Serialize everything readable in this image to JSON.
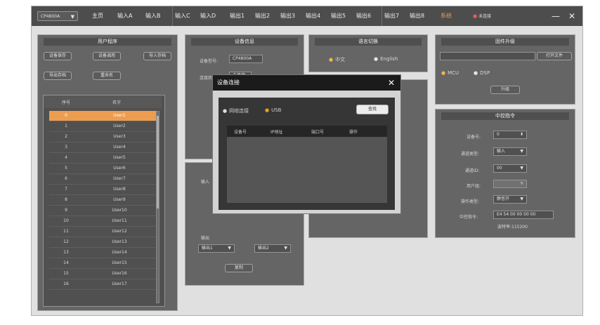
{
  "topbar": {
    "device_select": "CP4800A",
    "nav": [
      "主页",
      "输入A",
      "输入B",
      "输入C",
      "输入D",
      "输出1",
      "输出2",
      "输出3",
      "输出4",
      "输出5",
      "输出6",
      "输出7",
      "输出8",
      "系统"
    ],
    "active_nav": "系统",
    "connection_status": "未连接",
    "minimize": "—",
    "close": "✕"
  },
  "user_program": {
    "title": "用户程序",
    "buttons": [
      "设备保存",
      "设备调用",
      "导入存档",
      "导出存档",
      "重命名"
    ],
    "table": {
      "headers": [
        "序号",
        "名字"
      ],
      "rows": [
        [
          "0",
          "User1"
        ],
        [
          "1",
          "User2"
        ],
        [
          "2",
          "User3"
        ],
        [
          "3",
          "User4"
        ],
        [
          "4",
          "User5"
        ],
        [
          "5",
          "User6"
        ],
        [
          "6",
          "User7"
        ],
        [
          "7",
          "User8"
        ],
        [
          "8",
          "User9"
        ],
        [
          "9",
          "User10"
        ],
        [
          "10",
          "User11"
        ],
        [
          "11",
          "User12"
        ],
        [
          "12",
          "User13"
        ],
        [
          "13",
          "User14"
        ],
        [
          "14",
          "User15"
        ],
        [
          "15",
          "User16"
        ],
        [
          "16",
          "User17"
        ]
      ],
      "selected_index": 0
    }
  },
  "device_info": {
    "title": "设备信息",
    "model_label": "设备型号:",
    "model_value": "CP4800A",
    "conn_label": "连接状态:",
    "conn_value": "未连接",
    "output_label": "输出",
    "output_from": "输出1",
    "output_to": "输出2",
    "copy_button": "复制",
    "partial_input": "输入"
  },
  "language": {
    "title": "语言切换",
    "options": [
      "中文",
      "English"
    ],
    "selected": "中文"
  },
  "firmware": {
    "title": "固件升级",
    "path_value": "",
    "open_button": "打开文件",
    "targets": [
      "MCU",
      "DSP"
    ],
    "selected": "MCU",
    "upgrade_button": "升级"
  },
  "central_control": {
    "title": "中控指令",
    "device_no_label": "设备号:",
    "device_no": "0",
    "channel_type_label": "通道类型:",
    "channel_type": "输入",
    "channel_id_label": "通道ID:",
    "channel_id": "00",
    "user_label": "用户组:",
    "user_value": "",
    "op_type_label": "操作类型:",
    "op_type": "静音开",
    "command_label": "中控指令:",
    "command_value": "E4 54 00 00 00 00",
    "baud_text": "波特率:115200"
  },
  "dialog": {
    "title": "设备连接",
    "close": "✕",
    "modes": [
      "网络连接",
      "USB"
    ],
    "selected_mode": "USB",
    "search_button": "查找",
    "grid_headers": [
      "设备号",
      "IP地址",
      "端口号",
      "操作"
    ]
  },
  "colors": {
    "accent": "#e8821e",
    "background": "#3a3a3a",
    "titlebar": "#1c1c1c"
  }
}
